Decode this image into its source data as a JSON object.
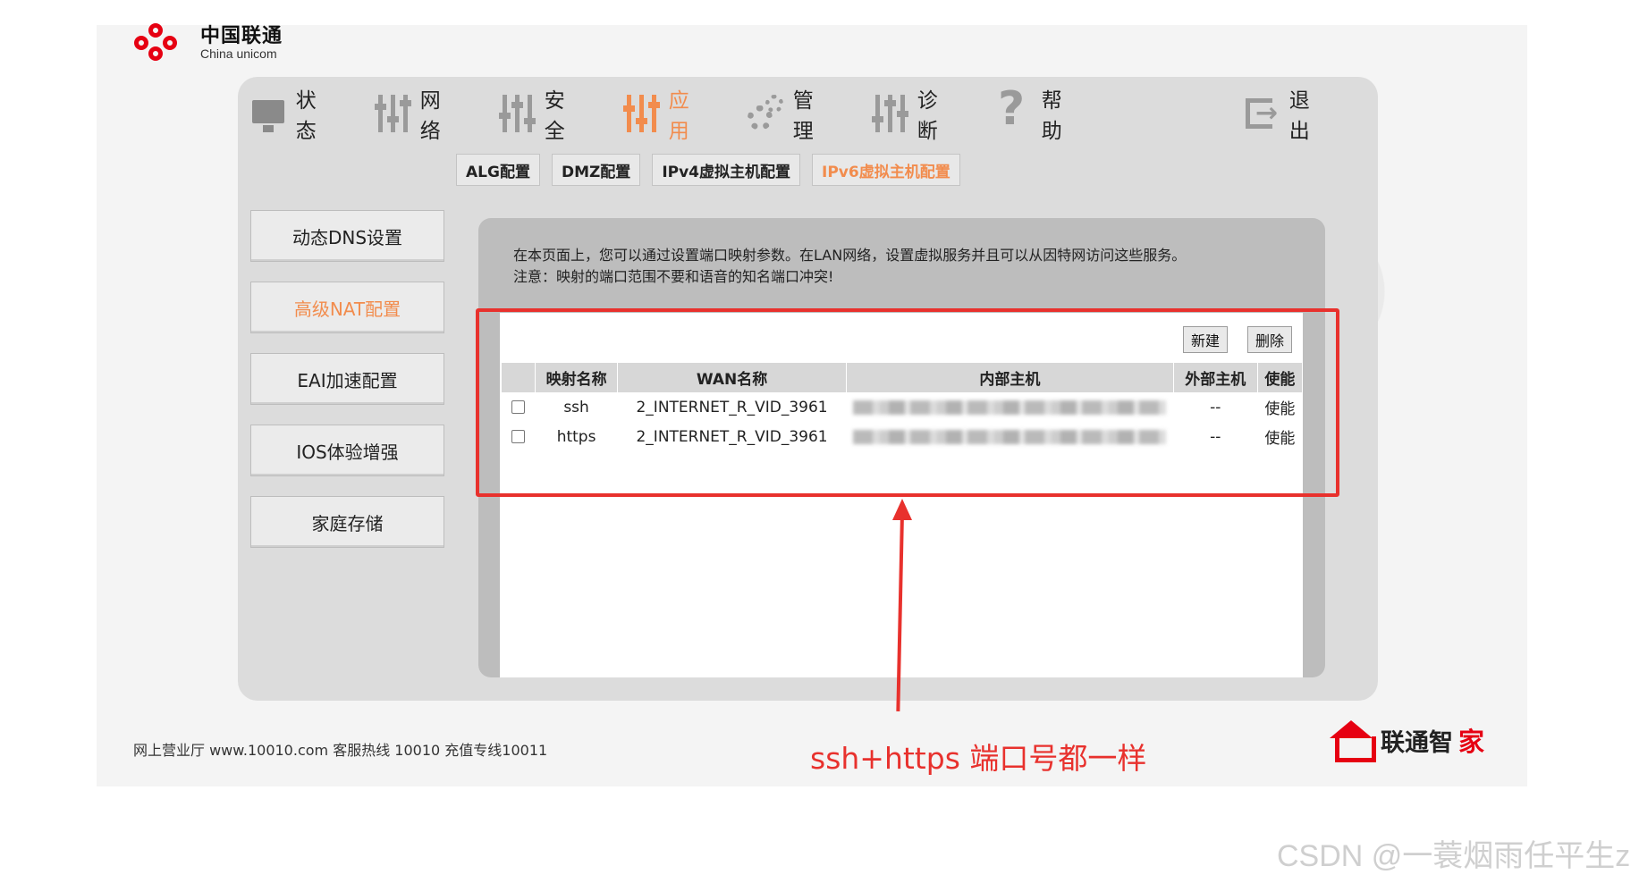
{
  "brand": {
    "name_cn": "中国联通",
    "name_en": "China unicom"
  },
  "topnav": [
    {
      "label": "状态",
      "icon": "monitor-icon"
    },
    {
      "label": "网络",
      "icon": "sliders-icon"
    },
    {
      "label": "安全",
      "icon": "sliders-icon"
    },
    {
      "label": "应用",
      "icon": "sliders-icon",
      "active": true
    },
    {
      "label": "管理",
      "icon": "gear-icon"
    },
    {
      "label": "诊断",
      "icon": "sliders-icon"
    },
    {
      "label": "帮助",
      "icon": "question-icon"
    },
    {
      "label": "退出",
      "icon": "exit-icon"
    }
  ],
  "subtabs": [
    {
      "label": "ALG配置"
    },
    {
      "label": "DMZ配置"
    },
    {
      "label": "IPv4虚拟主机配置"
    },
    {
      "label": "IPv6虚拟主机配置",
      "active": true
    }
  ],
  "sidebar": [
    {
      "label": "动态DNS设置"
    },
    {
      "label": "高级NAT配置",
      "active": true
    },
    {
      "label": "EAI加速配置"
    },
    {
      "label": "IOS体验增强"
    },
    {
      "label": "家庭存储"
    }
  ],
  "intro": {
    "line1": "在本页面上，您可以通过设置端口映射参数。在LAN网络，设置虚拟服务并且可以从因特网访问这些服务。",
    "line2": "注意：映射的端口范围不要和语音的知名端口冲突!"
  },
  "buttons": {
    "new": "新建",
    "delete": "删除"
  },
  "table": {
    "headers": [
      "",
      "映射名称",
      "WAN名称",
      "内部主机",
      "外部主机",
      "使能"
    ],
    "rows": [
      {
        "name": "ssh",
        "wan": "2_INTERNET_R_VID_3961",
        "external": "--",
        "enable": "使能"
      },
      {
        "name": "https",
        "wan": "2_INTERNET_R_VID_3961",
        "external": "--",
        "enable": "使能"
      }
    ]
  },
  "annotation": "ssh+https 端口号都一样",
  "footer": "网上营业厅 www.10010.com  客服热线  10010  充值专线10011",
  "app_logo": {
    "part1": "联通智",
    "part2": "家"
  },
  "watermark": "CSDN @一蓑烟雨任平生z",
  "colors": {
    "accent": "#f28c4d",
    "annotation_red": "#e8312d",
    "brand_red": "#e60012"
  }
}
